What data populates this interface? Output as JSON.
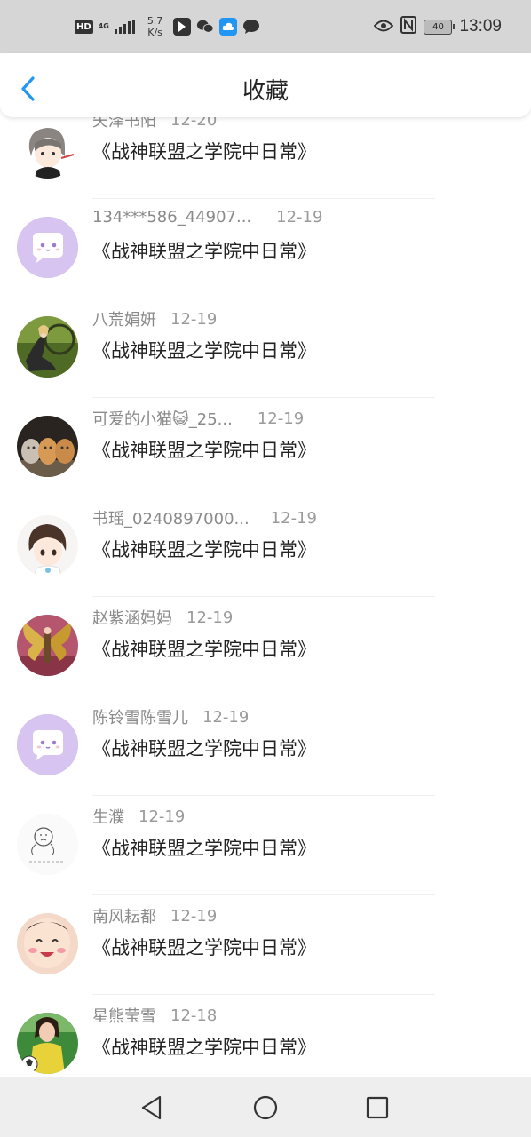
{
  "status_bar": {
    "hd": "HD",
    "network": "4G",
    "speed_value": "5.7",
    "speed_unit": "K/s",
    "battery": "40",
    "time": "13:09"
  },
  "header": {
    "title": "收藏",
    "back_icon": "chevron-left-icon",
    "accent_color": "#2196f3"
  },
  "favorites": [
    {
      "user": "矢泽书阳",
      "date": "12-20",
      "title": "《战神联盟之学院中日常》",
      "avatar": "anime-girl"
    },
    {
      "user": "134***586_44907...",
      "date": "12-19",
      "title": "《战神联盟之学院中日常》",
      "avatar": "default-chat"
    },
    {
      "user": "八荒娟妍",
      "date": "12-19",
      "title": "《战神联盟之学院中日常》",
      "avatar": "photo-green"
    },
    {
      "user": "可爱的小猫😺_25...",
      "date": "12-19",
      "title": "《战神联盟之学院中日常》",
      "avatar": "cats-photo"
    },
    {
      "user": "书瑶_0240897000...",
      "date": "12-19",
      "title": "《战神联盟之学院中日常》",
      "avatar": "anime-boy"
    },
    {
      "user": "赵紫涵妈妈",
      "date": "12-19",
      "title": "《战神联盟之学院中日常》",
      "avatar": "photo-butterfly"
    },
    {
      "user": "陈铃雪陈雪儿",
      "date": "12-19",
      "title": "《战神联盟之学院中日常》",
      "avatar": "default-chat"
    },
    {
      "user": "生濮",
      "date": "12-19",
      "title": "《战神联盟之学院中日常》",
      "avatar": "sketch"
    },
    {
      "user": "南风耘都",
      "date": "12-19",
      "title": "《战神联盟之学院中日常》",
      "avatar": "baby-photo"
    },
    {
      "user": "星熊莹雪",
      "date": "12-18",
      "title": "《战神联盟之学院中日常》",
      "avatar": "photo-soccer"
    }
  ],
  "navbar": {
    "back_icon": "triangle-back-icon",
    "home_icon": "circle-home-icon",
    "recents_icon": "square-recents-icon"
  }
}
